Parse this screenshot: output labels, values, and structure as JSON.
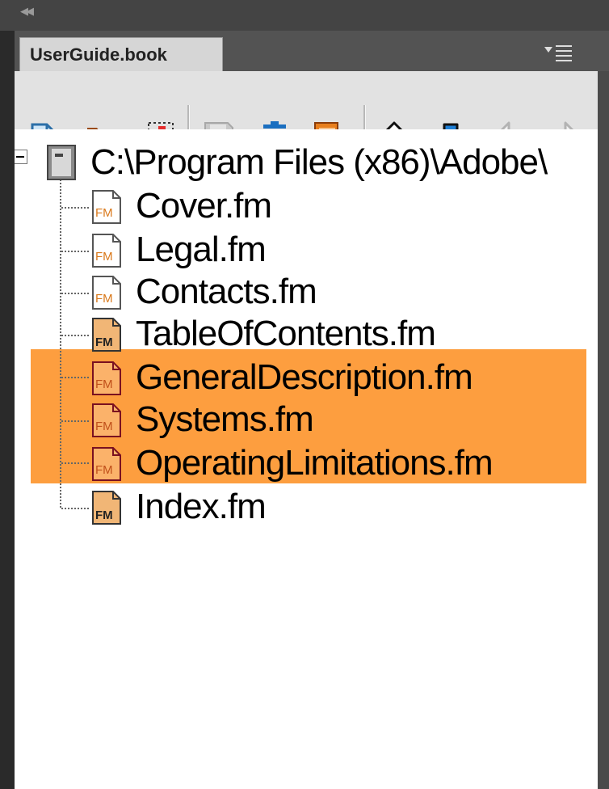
{
  "window": {
    "collapse_icon": "collapse-double-chevron-icon"
  },
  "panel": {
    "tab_label": "UserGuide.book",
    "menu_icon": "panel-menu-icon"
  },
  "toolbar": {
    "buttons": [
      {
        "icon": "add-file-icon",
        "enabled": true
      },
      {
        "icon": "add-folder-icon",
        "enabled": true
      },
      {
        "icon": "add-group-icon",
        "enabled": true
      },
      {
        "icon": "save-icon",
        "enabled": false
      },
      {
        "icon": "delete-icon",
        "enabled": true
      },
      {
        "icon": "update-book-icon",
        "enabled": true
      },
      {
        "icon": "move-up-icon",
        "enabled": true
      },
      {
        "icon": "move-down-icon",
        "enabled": true
      },
      {
        "icon": "demote-left-icon",
        "enabled": false
      },
      {
        "icon": "promote-right-icon",
        "enabled": false
      }
    ]
  },
  "tree": {
    "root": {
      "label": "C:\\Program Files (x86)\\Adobe\\",
      "expanded": true
    },
    "files": [
      {
        "label": "Cover.fm",
        "selected": false
      },
      {
        "label": "Legal.fm",
        "selected": false
      },
      {
        "label": "Contacts.fm",
        "selected": false
      },
      {
        "label": "TableOfContents.fm",
        "selected": false
      },
      {
        "label": "GeneralDescription.fm",
        "selected": true
      },
      {
        "label": "Systems.fm",
        "selected": true
      },
      {
        "label": "OperatingLimitations.fm",
        "selected": true
      },
      {
        "label": "Index.fm",
        "selected": false
      }
    ],
    "selection_color": "#fd9e3f"
  }
}
